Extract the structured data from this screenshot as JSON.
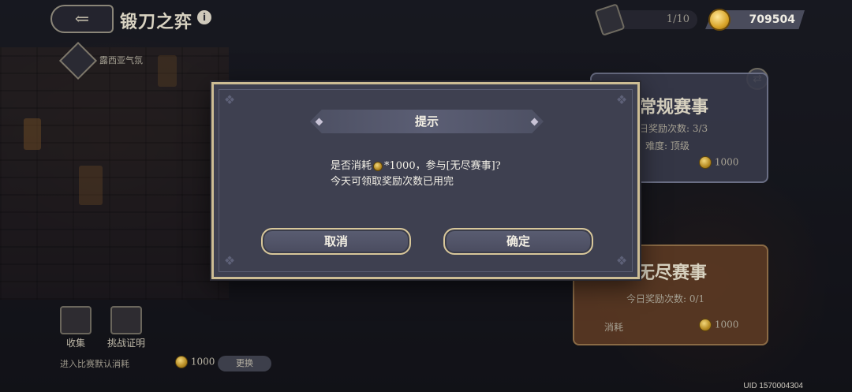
{
  "header": {
    "back_icon": "back-arrow-icon",
    "title": "锻刀之弈",
    "info_icon": "info-icon",
    "tickets": "1/10",
    "coins": "709504"
  },
  "left": {
    "atmosphere_label": "露西亚气氛",
    "collect_label": "收集",
    "challenge_label": "挑战证明",
    "default_cost_label": "进入比赛默认消耗",
    "default_cost_value": "1000",
    "change_label": "更换"
  },
  "cards": {
    "regular": {
      "title": "常规赛事",
      "reward_count": "日奖励次数: 3/3",
      "difficulty": "难度: 顶级",
      "cost": "1000"
    },
    "endless": {
      "title": "无尽赛事",
      "reward_count": "今日奖励次数: 0/1",
      "cost_label": "消耗",
      "cost": "1000"
    }
  },
  "dialog": {
    "title": "提示",
    "line1_prefix": "是否消耗",
    "line1_suffix": "*1000，参与[无尽赛事]?",
    "line2": "今天可领取奖励次数已用完",
    "cancel_label": "取消",
    "confirm_label": "确定"
  },
  "footer": {
    "uid": "UID 1570004304"
  },
  "colors": {
    "dialog_bg": "#3e4050",
    "dialog_border": "#cdbd94",
    "coin_gold": "#d9a52a"
  }
}
